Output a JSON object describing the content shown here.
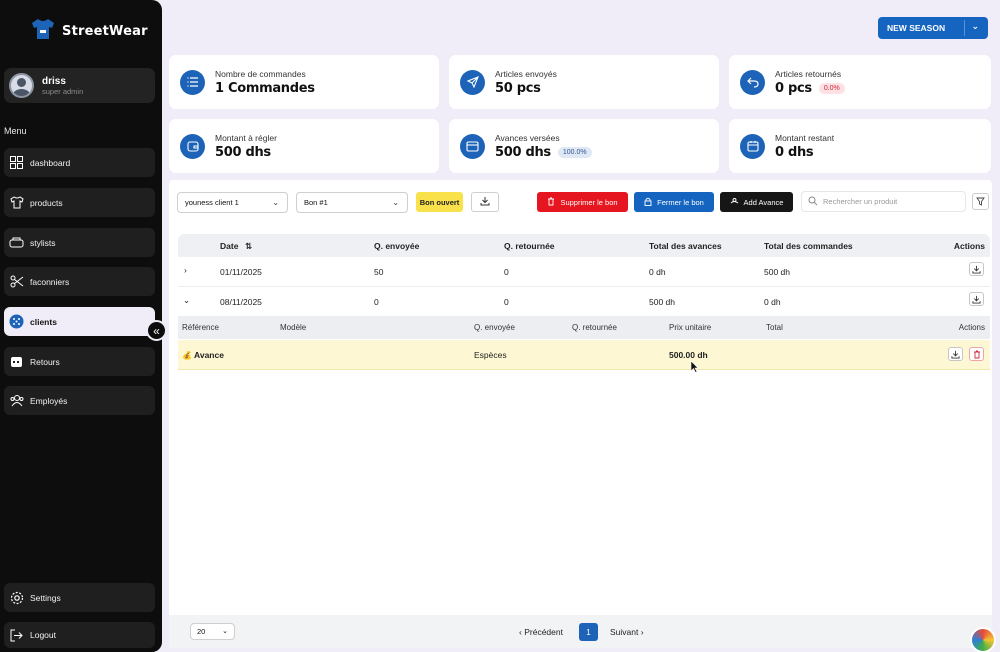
{
  "app": {
    "name": "StreetWear"
  },
  "user": {
    "name": "driss",
    "role": "super admin"
  },
  "sidebar": {
    "menu_label": "Menu",
    "items": [
      {
        "label": "dashboard",
        "icon": "grid-icon"
      },
      {
        "label": "products",
        "icon": "shirt-icon"
      },
      {
        "label": "stylists",
        "icon": "users-icon"
      },
      {
        "label": "faconniers",
        "icon": "scissors-icon"
      },
      {
        "label": "clients",
        "icon": "globe-icon",
        "active": true
      },
      {
        "label": "Retours",
        "icon": "calendar-icon"
      },
      {
        "label": "Employés",
        "icon": "team-icon"
      }
    ],
    "settings": "Settings",
    "logout": "Logout",
    "collapse_glyph": "«"
  },
  "header": {
    "season_button": "NEW SEASON"
  },
  "stats": [
    {
      "label": "Nombre de commandes",
      "value": "1 Commandes",
      "icon": "list-icon"
    },
    {
      "label": "Articles envoyés",
      "value": "50 pcs",
      "icon": "send-icon"
    },
    {
      "label": "Articles retournés",
      "value": "0 pcs",
      "badge": "0.0%",
      "icon": "undo-icon"
    },
    {
      "label": "Montant à régler",
      "value": "500 dhs",
      "icon": "wallet-icon"
    },
    {
      "label": "Avances versées",
      "value": "500 dhs",
      "badge": "100.0%",
      "icon": "card-icon"
    },
    {
      "label": "Montant restant",
      "value": "0 dhs",
      "icon": "calendar-icon"
    }
  ],
  "toolbar": {
    "client_select": "youness client 1",
    "bon_select": "Bon #1",
    "status_badge": "Bon ouvert",
    "delete_button": "Supprimer le bon",
    "close_button": "Fermer le bon",
    "add_advance_button": "Add Avance",
    "search_placeholder": "Rechercher un produit"
  },
  "table": {
    "headers": [
      "Date",
      "Q. envoyée",
      "Q. retournée",
      "Total des avances",
      "Total des commandes",
      "Actions"
    ],
    "rows": [
      {
        "date": "01/11/2025",
        "sent": "50",
        "returned": "0",
        "advances": "0 dh",
        "orders": "500 dh",
        "expanded": false
      },
      {
        "date": "08/11/2025",
        "sent": "0",
        "returned": "0",
        "advances": "500 dh",
        "orders": "0 dh",
        "expanded": true
      }
    ],
    "sub_headers": [
      "Référence",
      "Modèle",
      "Q. envoyée",
      "Q. retournée",
      "Prix unitaire",
      "Total",
      "Actions"
    ],
    "sub_rows": [
      {
        "reference": "Avance",
        "model": "",
        "sent": "Espèces",
        "returned": "",
        "unit_price": "500.00 dh",
        "total": ""
      }
    ]
  },
  "pagination": {
    "page_size": "20",
    "prev": "Précédent",
    "current": "1",
    "next": "Suivant"
  },
  "colors": {
    "primary": "#1565c0",
    "danger": "#e5161f",
    "highlight": "#fdf8d3",
    "badge": "#f9e14b"
  }
}
